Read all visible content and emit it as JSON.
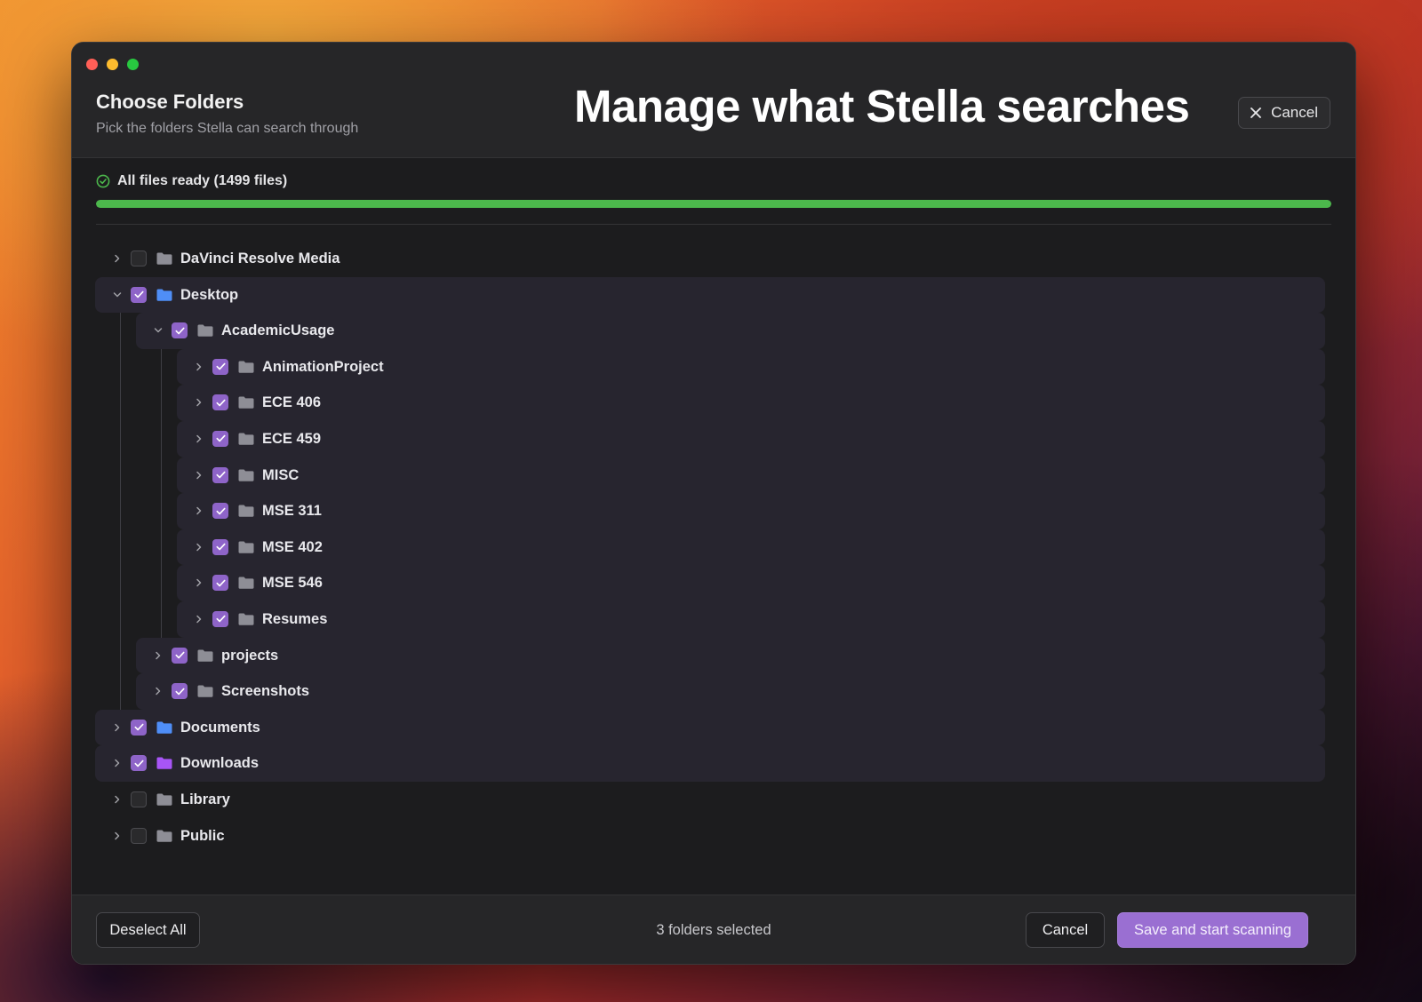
{
  "header": {
    "title": "Choose Folders",
    "subtitle": "Pick the folders Stella can search through",
    "overlay_title": "Manage what Stella searches",
    "close_label": "Cancel"
  },
  "status": {
    "text": "All files ready (1499 files)",
    "progress": 1.0,
    "color": "#4cb84c"
  },
  "tree": [
    {
      "label": "DaVinci Resolve Media",
      "depth": 0,
      "checked": false,
      "expanded": false,
      "folder_color": "gray"
    },
    {
      "label": "Desktop",
      "depth": 0,
      "checked": true,
      "expanded": true,
      "folder_color": "blue"
    },
    {
      "label": "AcademicUsage",
      "depth": 1,
      "checked": true,
      "expanded": true,
      "folder_color": "gray"
    },
    {
      "label": "AnimationProject",
      "depth": 2,
      "checked": true,
      "expanded": false,
      "folder_color": "gray"
    },
    {
      "label": "ECE 406",
      "depth": 2,
      "checked": true,
      "expanded": false,
      "folder_color": "gray"
    },
    {
      "label": "ECE 459",
      "depth": 2,
      "checked": true,
      "expanded": false,
      "folder_color": "gray"
    },
    {
      "label": "MISC",
      "depth": 2,
      "checked": true,
      "expanded": false,
      "folder_color": "gray"
    },
    {
      "label": "MSE 311",
      "depth": 2,
      "checked": true,
      "expanded": false,
      "folder_color": "gray"
    },
    {
      "label": "MSE 402",
      "depth": 2,
      "checked": true,
      "expanded": false,
      "folder_color": "gray"
    },
    {
      "label": "MSE 546",
      "depth": 2,
      "checked": true,
      "expanded": false,
      "folder_color": "gray"
    },
    {
      "label": "Resumes",
      "depth": 2,
      "checked": true,
      "expanded": false,
      "folder_color": "gray"
    },
    {
      "label": "projects",
      "depth": 1,
      "checked": true,
      "expanded": false,
      "folder_color": "gray"
    },
    {
      "label": "Screenshots",
      "depth": 1,
      "checked": true,
      "expanded": false,
      "folder_color": "gray"
    },
    {
      "label": "Documents",
      "depth": 0,
      "checked": true,
      "expanded": false,
      "folder_color": "blue"
    },
    {
      "label": "Downloads",
      "depth": 0,
      "checked": true,
      "expanded": false,
      "folder_color": "purple"
    },
    {
      "label": "Library",
      "depth": 0,
      "checked": false,
      "expanded": false,
      "folder_color": "gray"
    },
    {
      "label": "Public",
      "depth": 0,
      "checked": false,
      "expanded": false,
      "folder_color": "gray"
    }
  ],
  "footer": {
    "deselect_label": "Deselect All",
    "selection_text": "3 folders selected",
    "cancel_label": "Cancel",
    "save_label": "Save and start scanning"
  },
  "colors": {
    "accent": "#9a6fd2",
    "checkbox_on": "#8e64c8",
    "folder_gray": "#8e8e96",
    "folder_blue": "#4f8ef7",
    "folder_purple": "#a855f7"
  }
}
